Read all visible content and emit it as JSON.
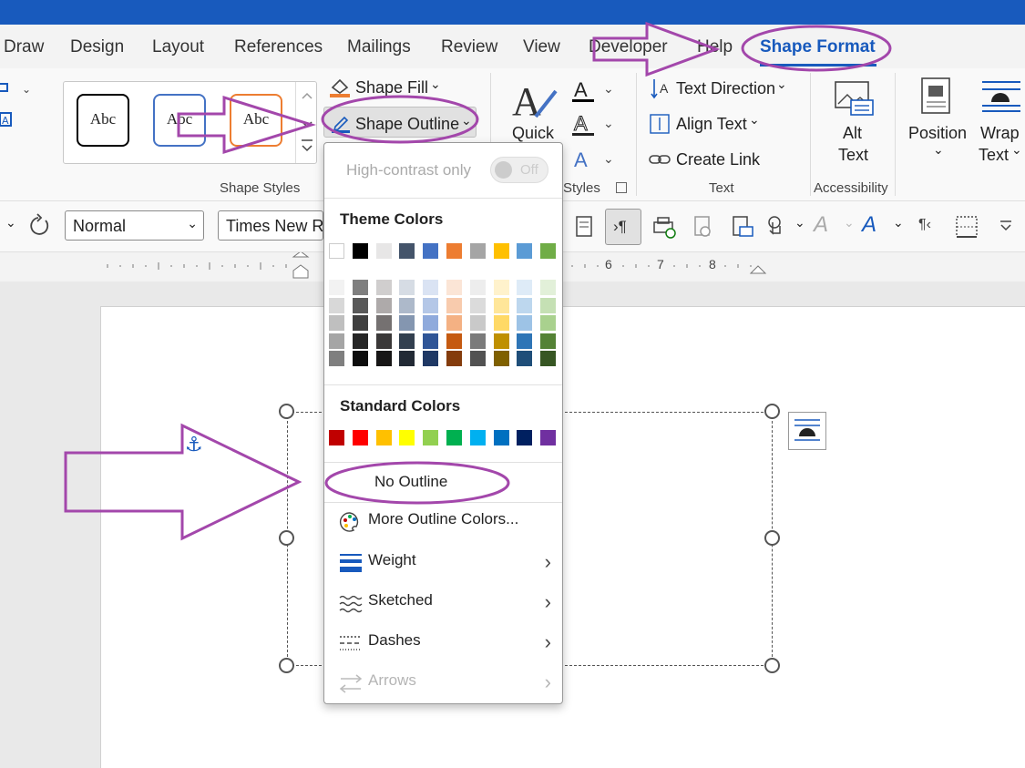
{
  "tabs": [
    "Draw",
    "Design",
    "Layout",
    "References",
    "Mailings",
    "Review",
    "View",
    "Developer",
    "Help",
    "Shape Format"
  ],
  "shape_styles": {
    "samples": [
      "Abc",
      "Abc",
      "Abc"
    ],
    "shape_fill": "Shape Fill",
    "shape_outline": "Shape Outline",
    "group_label": "Shape Styles"
  },
  "wordart": {
    "quick_label": "Quick",
    "group_label": "Styles"
  },
  "text_group": {
    "text_direction": "Text Direction",
    "align_text": "Align Text",
    "create_link": "Create Link",
    "group_label": "Text"
  },
  "accessibility": {
    "alt_line1": "Alt",
    "alt_line2": "Text",
    "group_label": "Accessibility"
  },
  "arrange": {
    "position": "Position",
    "wrap_line1": "Wrap",
    "wrap_line2": "Text"
  },
  "format_bar": {
    "style_value": "Normal",
    "font_value": "Times New R"
  },
  "ruler_numbers": [
    "6",
    "7",
    "8"
  ],
  "menu": {
    "high_contrast": "High-contrast only",
    "toggle_state": "Off",
    "theme_heading": "Theme Colors",
    "theme_colors": [
      "#ffffff",
      "#000000",
      "#e7e6e6",
      "#44546a",
      "#4472c4",
      "#ed7d31",
      "#a5a5a5",
      "#ffc000",
      "#5b9bd5",
      "#70ad47"
    ],
    "theme_shades": [
      [
        "#f2f2f2",
        "#d8d8d8",
        "#bfbfbf",
        "#a5a5a5",
        "#7f7f7f"
      ],
      [
        "#7f7f7f",
        "#595959",
        "#3f3f3f",
        "#262626",
        "#0d0d0d"
      ],
      [
        "#d0cece",
        "#aeaaaa",
        "#757171",
        "#3a3838",
        "#171616"
      ],
      [
        "#d6dce4",
        "#adb9ca",
        "#8496b0",
        "#323f4f",
        "#222a35"
      ],
      [
        "#dae3f3",
        "#b4c7e7",
        "#8faadc",
        "#2f5597",
        "#1f3864"
      ],
      [
        "#fbe5d6",
        "#f8cbad",
        "#f4b183",
        "#c55a11",
        "#843c0c"
      ],
      [
        "#ededed",
        "#dbdbdb",
        "#c9c9c9",
        "#7b7b7b",
        "#525252"
      ],
      [
        "#fff2cc",
        "#ffe699",
        "#ffd966",
        "#bf9000",
        "#7f6000"
      ],
      [
        "#deebf7",
        "#bdd7ee",
        "#9dc3e6",
        "#2e75b6",
        "#1f4e79"
      ],
      [
        "#e2f0d9",
        "#c5e0b4",
        "#a9d18e",
        "#548235",
        "#375623"
      ]
    ],
    "standard_heading": "Standard Colors",
    "standard_colors": [
      "#c00000",
      "#ff0000",
      "#ffc000",
      "#ffff00",
      "#92d050",
      "#00b050",
      "#00b0f0",
      "#0070c0",
      "#002060",
      "#7030a0"
    ],
    "no_outline": "No Outline",
    "more_colors": "More Outline Colors...",
    "weight": "Weight",
    "sketched": "Sketched",
    "dashes": "Dashes",
    "arrows": "Arrows"
  },
  "colors": {
    "accent": "#185abd",
    "annotation": "#a347ab"
  }
}
